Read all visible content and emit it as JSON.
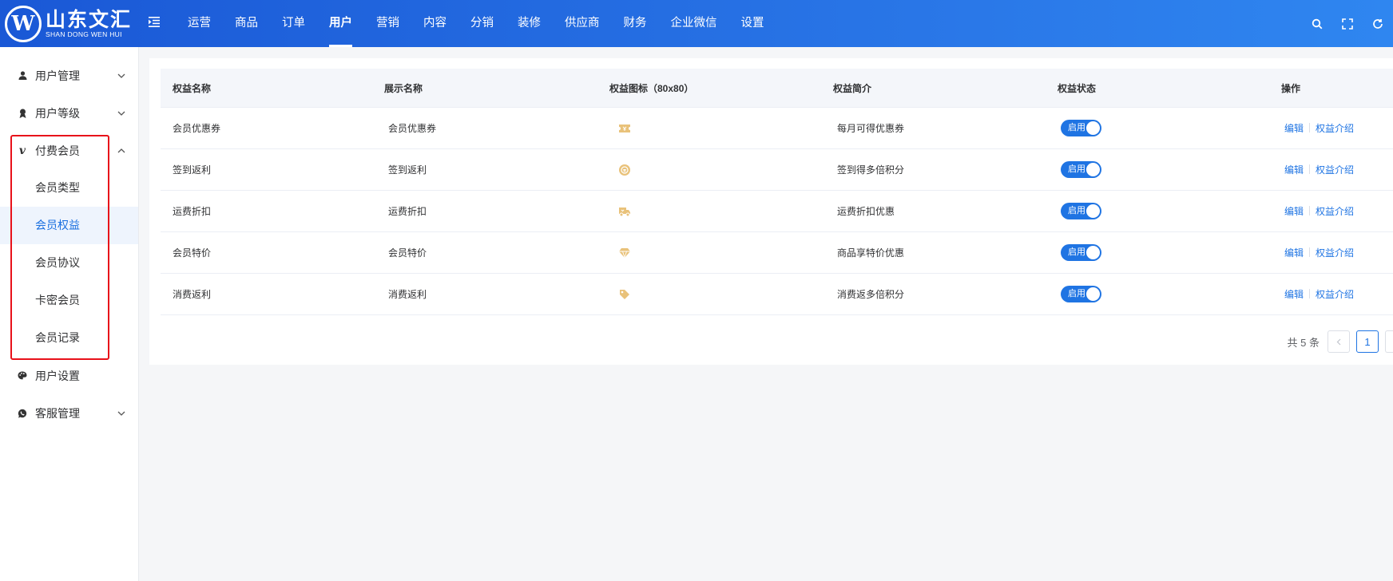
{
  "brand": {
    "mark": "W",
    "name_cn": "山东文汇",
    "name_en": "SHAN DONG WEN HUI"
  },
  "nav": [
    {
      "label": "运营",
      "active": false
    },
    {
      "label": "商品",
      "active": false
    },
    {
      "label": "订单",
      "active": false
    },
    {
      "label": "用户",
      "active": true
    },
    {
      "label": "营销",
      "active": false
    },
    {
      "label": "内容",
      "active": false
    },
    {
      "label": "分销",
      "active": false
    },
    {
      "label": "装修",
      "active": false
    },
    {
      "label": "供应商",
      "active": false
    },
    {
      "label": "财务",
      "active": false
    },
    {
      "label": "企业微信",
      "active": false
    },
    {
      "label": "设置",
      "active": false
    }
  ],
  "sidebar": {
    "user_mgmt": "用户管理",
    "user_level": "用户等级",
    "paid_member": "付费会员",
    "paid_sub": [
      "会员类型",
      "会员权益",
      "会员协议",
      "卡密会员",
      "会员记录"
    ],
    "active_sub": "会员权益",
    "user_settings": "用户设置",
    "service_mgmt": "客服管理"
  },
  "table": {
    "headers": [
      "权益名称",
      "展示名称",
      "权益图标（80x80）",
      "权益简介",
      "权益状态",
      "操作"
    ],
    "rows": [
      {
        "name": "会员优惠券",
        "display": "会员优惠券",
        "icon": "coupon-icon",
        "intro": "每月可得优惠券",
        "status": "启用"
      },
      {
        "name": "签到返利",
        "display": "签到返利",
        "icon": "coin-icon",
        "intro": "签到得多倍积分",
        "status": "启用"
      },
      {
        "name": "运费折扣",
        "display": "运费折扣",
        "icon": "truck-icon",
        "intro": "运费折扣优惠",
        "status": "启用"
      },
      {
        "name": "会员特价",
        "display": "会员特价",
        "icon": "diamond-icon",
        "intro": "商品享特价优惠",
        "status": "启用"
      },
      {
        "name": "消费返利",
        "display": "消费返利",
        "icon": "tag-icon",
        "intro": "消费返多倍积分",
        "status": "启用"
      }
    ],
    "actions": {
      "edit": "编辑",
      "intro": "权益介绍"
    }
  },
  "pager": {
    "total": "共 5 条",
    "current": "1"
  },
  "colors": {
    "primary": "#1f74e3",
    "header_start": "#1a58d6",
    "header_end": "#2f86f0",
    "highlight": "#e8111a",
    "icon_gold": "#e9c27a"
  }
}
